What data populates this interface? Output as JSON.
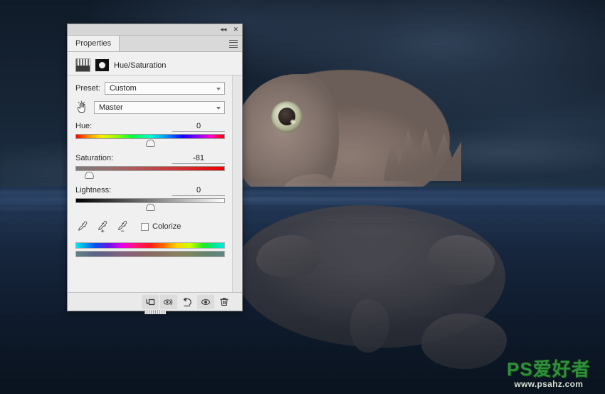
{
  "panel": {
    "titlebar": {
      "collapse_label": "◂◂",
      "close_label": "✕"
    },
    "tab_label": "Properties",
    "menu_icon": "hamburger-menu-icon",
    "adjustment": {
      "icon": "hue-saturation-adjustment-icon",
      "mask_icon": "layer-mask-thumbnail-icon",
      "title": "Hue/Saturation"
    },
    "preset": {
      "label": "Preset:",
      "value": "Custom"
    },
    "channel": {
      "targeted_adjustment_icon": "hand-targeted-adjustment-icon",
      "value": "Master"
    },
    "sliders": [
      {
        "name": "hue",
        "label": "Hue:",
        "value": "0",
        "thumb_percent": 50
      },
      {
        "name": "saturation",
        "label": "Saturation:",
        "value": "-81",
        "thumb_percent": 9.5
      },
      {
        "name": "lightness",
        "label": "Lightness:",
        "value": "0",
        "thumb_percent": 50
      }
    ],
    "tools": {
      "eyedropper": "eyedropper-icon",
      "eyedropper_add": "eyedropper-add-icon",
      "eyedropper_subtract": "eyedropper-subtract-icon",
      "colorize_label": "Colorize",
      "colorize_checked": false
    },
    "color_bars": {
      "top": "vivid-hue-range-bar",
      "bottom": "adjusted-hue-range-bar"
    },
    "footer_buttons": [
      {
        "name": "clip-to-layer-button",
        "icon": "clip-to-layer-icon",
        "active": true
      },
      {
        "name": "view-previous-state-button",
        "icon": "eye-previous-state-icon",
        "active": true
      },
      {
        "name": "reset-button",
        "icon": "reset-arrow-icon",
        "active": false
      },
      {
        "name": "toggle-layer-visibility-button",
        "icon": "eye-icon",
        "active": true
      },
      {
        "name": "delete-layer-button",
        "icon": "trash-icon",
        "active": false
      }
    ],
    "scrollbar": "vertical-scrollbar",
    "resize_grip": "panel-resize-grip"
  },
  "watermark": {
    "main": "PS爱好者",
    "sub": "www.psahz.com"
  },
  "colors": {
    "background": "#0e1825",
    "panel_bg": "#f0f0f0",
    "watermark_green": "#2f8f3a"
  }
}
